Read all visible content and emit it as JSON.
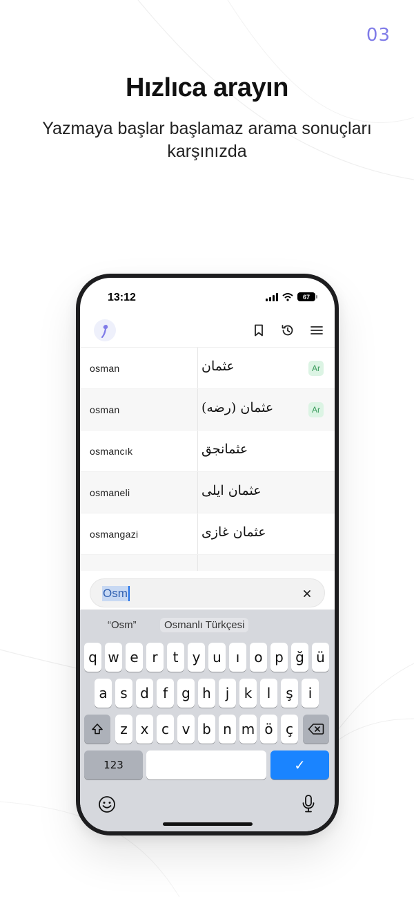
{
  "page_number": "03",
  "headline": "Hızlıca arayın",
  "subhead": "Yazmaya başlar başlamaz arama sonuçları karşınızda",
  "status_bar": {
    "time": "13:12",
    "battery": "67"
  },
  "results": [
    {
      "term": "osman",
      "ottoman": "عثمان",
      "lang": "Ar"
    },
    {
      "term": "osman",
      "ottoman": "عثمان (رضه)",
      "lang": "Ar"
    },
    {
      "term": "osmancık",
      "ottoman": "عثمانجق",
      "lang": ""
    },
    {
      "term": "osmaneli",
      "ottoman": "عثمان ايلى",
      "lang": ""
    },
    {
      "term": "osmangazi",
      "ottoman": "عثمان غازى",
      "lang": ""
    }
  ],
  "search": {
    "value": "Osm"
  },
  "keyboard": {
    "suggestions": [
      "“Osm”",
      "Osmanlı Türkçesi"
    ],
    "row1": [
      "q",
      "w",
      "e",
      "r",
      "t",
      "y",
      "u",
      "ı",
      "o",
      "p",
      "ğ",
      "ü"
    ],
    "row2": [
      "a",
      "s",
      "d",
      "f",
      "g",
      "h",
      "j",
      "k",
      "l",
      "ş",
      "i"
    ],
    "row3": [
      "z",
      "x",
      "c",
      "v",
      "b",
      "n",
      "m",
      "ö",
      "ç"
    ],
    "numbers_label": "123",
    "done_label": "✓"
  },
  "icons": {
    "bookmark": "bookmark-icon",
    "history": "history-icon",
    "menu": "menu-icon",
    "clear": "close-icon",
    "shift": "shift-icon",
    "backspace": "backspace-icon",
    "emoji": "emoji-icon",
    "mic": "microphone-icon"
  },
  "colors": {
    "accent": "#7f7be8",
    "badge_bg": "#dcf4e4",
    "badge_text": "#3c9c5e",
    "done_key": "#1a84ff"
  }
}
